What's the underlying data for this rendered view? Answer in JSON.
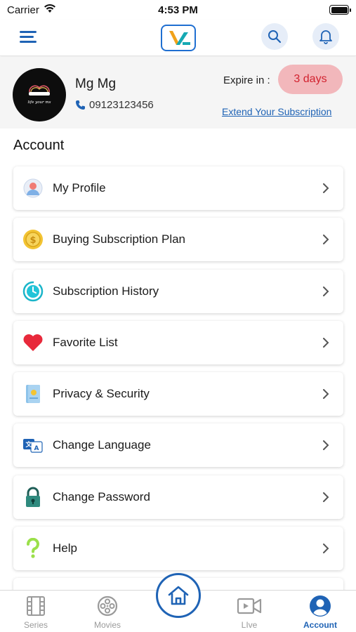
{
  "status_bar": {
    "carrier": "Carrier",
    "time": "4:53 PM"
  },
  "header": {
    "logo_icon": "v-logo-icon",
    "search_icon": "search-icon",
    "notification_icon": "bell-icon",
    "menu_icon": "hamburger-menu-icon"
  },
  "profile": {
    "name": "Mg Mg",
    "phone": "09123123456",
    "avatar_text": "life your ms",
    "expire_label": "Expire in :",
    "expire_value": "3 days",
    "extend_link": "Extend Your Subscription"
  },
  "section_title": "Account",
  "menu_items": [
    {
      "label": "My Profile",
      "icon": "user-profile-icon"
    },
    {
      "label": "Buying Subscription Plan",
      "icon": "coin-icon"
    },
    {
      "label": "Subscription History",
      "icon": "clock-history-icon"
    },
    {
      "label": "Favorite List",
      "icon": "heart-icon"
    },
    {
      "label": "Privacy & Security",
      "icon": "document-icon"
    },
    {
      "label": "Change Language",
      "icon": "translate-icon"
    },
    {
      "label": "Change Password",
      "icon": "lock-icon"
    },
    {
      "label": "Help",
      "icon": "question-icon"
    }
  ],
  "bottom_nav": {
    "tabs": [
      {
        "label": "Series",
        "icon": "film-strip-icon"
      },
      {
        "label": "Movies",
        "icon": "film-reel-icon"
      },
      {
        "label": "LIve",
        "icon": "video-icon"
      },
      {
        "label": "Account",
        "icon": "account-icon"
      }
    ],
    "home_icon": "home-icon"
  },
  "colors": {
    "primary": "#1f63b5",
    "badge_bg": "#f2b7bb",
    "badge_text": "#d2222f",
    "header_bg": "#f5f5f5"
  }
}
